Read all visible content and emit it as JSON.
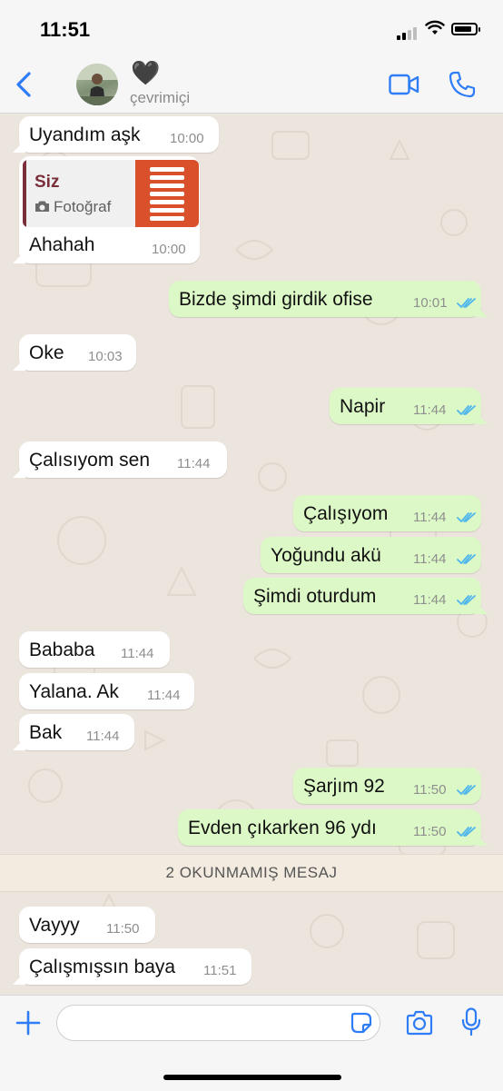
{
  "status_bar": {
    "time": "11:51",
    "battery_level": 0.88
  },
  "header": {
    "contact_name": "🖤",
    "status": "çevrimiçi",
    "icons": [
      "back-chevron-icon",
      "video-call-icon",
      "phone-call-icon"
    ],
    "accent_color": "#2e7cf6"
  },
  "messages": [
    {
      "dir": "in",
      "text": "Uyandım aşk",
      "time": "10:00"
    },
    {
      "dir": "in",
      "text": "Ahahah",
      "time": "10:00",
      "quote": {
        "author": "Siz",
        "label": "Fotoğraf"
      }
    },
    {
      "dir": "out",
      "text": "Bizde şimdi girdik ofise",
      "time": "10:01"
    },
    {
      "dir": "in",
      "text": "Oke",
      "time": "10:03"
    },
    {
      "dir": "out",
      "text": "Napir",
      "time": "11:44"
    },
    {
      "dir": "in",
      "text": "Çalısıyom sen",
      "time": "11:44"
    },
    {
      "dir": "out",
      "text": "Çalışıyom",
      "time": "11:44"
    },
    {
      "dir": "out",
      "text": "Yoğundu akü",
      "time": "11:44"
    },
    {
      "dir": "out",
      "text": "Şimdi oturdum",
      "time": "11:44"
    },
    {
      "dir": "in",
      "text": "Bababa",
      "time": "11:44"
    },
    {
      "dir": "in",
      "text": "Yalana. Ak",
      "time": "11:44"
    },
    {
      "dir": "in",
      "text": "Bak",
      "time": "11:44"
    },
    {
      "dir": "out",
      "text": "Şarjım 92",
      "time": "11:50"
    },
    {
      "dir": "out",
      "text": "Evden çıkarken 96 ydı",
      "time": "11:50"
    },
    {
      "dir": "in",
      "text": "Vayyy",
      "time": "11:50"
    },
    {
      "dir": "in",
      "text": "Çalışmışsın baya",
      "time": "11:51"
    }
  ],
  "unread_banner": "2 OKUNMAMIŞ MESAJ",
  "composer": {
    "placeholder": "",
    "icons": [
      "plus-icon",
      "sticker-icon",
      "camera-icon",
      "microphone-icon"
    ]
  },
  "colors": {
    "incoming_bubble": "#ffffff",
    "outgoing_bubble": "#dcf8c6",
    "read_ticks": "#4fb6ec",
    "chat_background": "#ece5dd"
  }
}
